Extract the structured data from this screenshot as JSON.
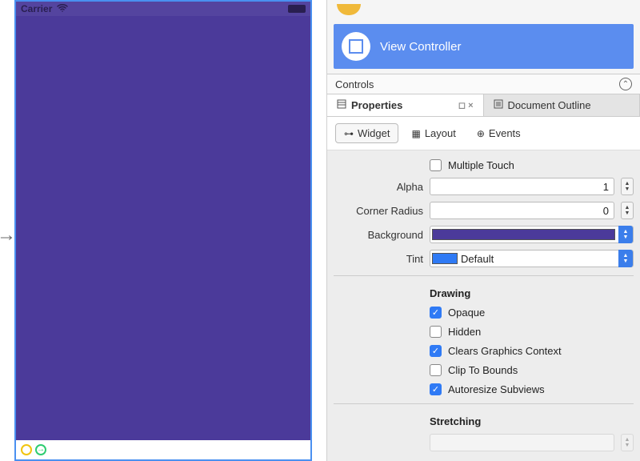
{
  "simulator": {
    "carrier": "Carrier",
    "body_color": "#4b3a9a"
  },
  "outline": {
    "selected_item": "View Controller",
    "controls_label": "Controls"
  },
  "pad_tabs": {
    "properties": "Properties",
    "document_outline": "Document Outline",
    "win_pin": "◻",
    "win_close": "×"
  },
  "sub_tabs": {
    "widget": "Widget",
    "layout": "Layout",
    "events": "Events"
  },
  "props": {
    "multiple_touch": {
      "label": "Multiple Touch",
      "checked": false
    },
    "alpha": {
      "label": "Alpha",
      "value": "1"
    },
    "corner_radius": {
      "label": "Corner Radius",
      "value": "0"
    },
    "background": {
      "label": "Background",
      "color": "#4b3a9a"
    },
    "tint": {
      "label": "Tint",
      "color": "#2f7af5",
      "text": "Default"
    },
    "drawing": {
      "header": "Drawing",
      "opaque": {
        "label": "Opaque",
        "checked": true
      },
      "hidden": {
        "label": "Hidden",
        "checked": false
      },
      "clears_graphics_context": {
        "label": "Clears Graphics Context",
        "checked": true
      },
      "clip_to_bounds": {
        "label": "Clip To Bounds",
        "checked": false
      },
      "autoresize_subviews": {
        "label": "Autoresize Subviews",
        "checked": true
      }
    },
    "stretching": {
      "header": "Stretching"
    }
  }
}
